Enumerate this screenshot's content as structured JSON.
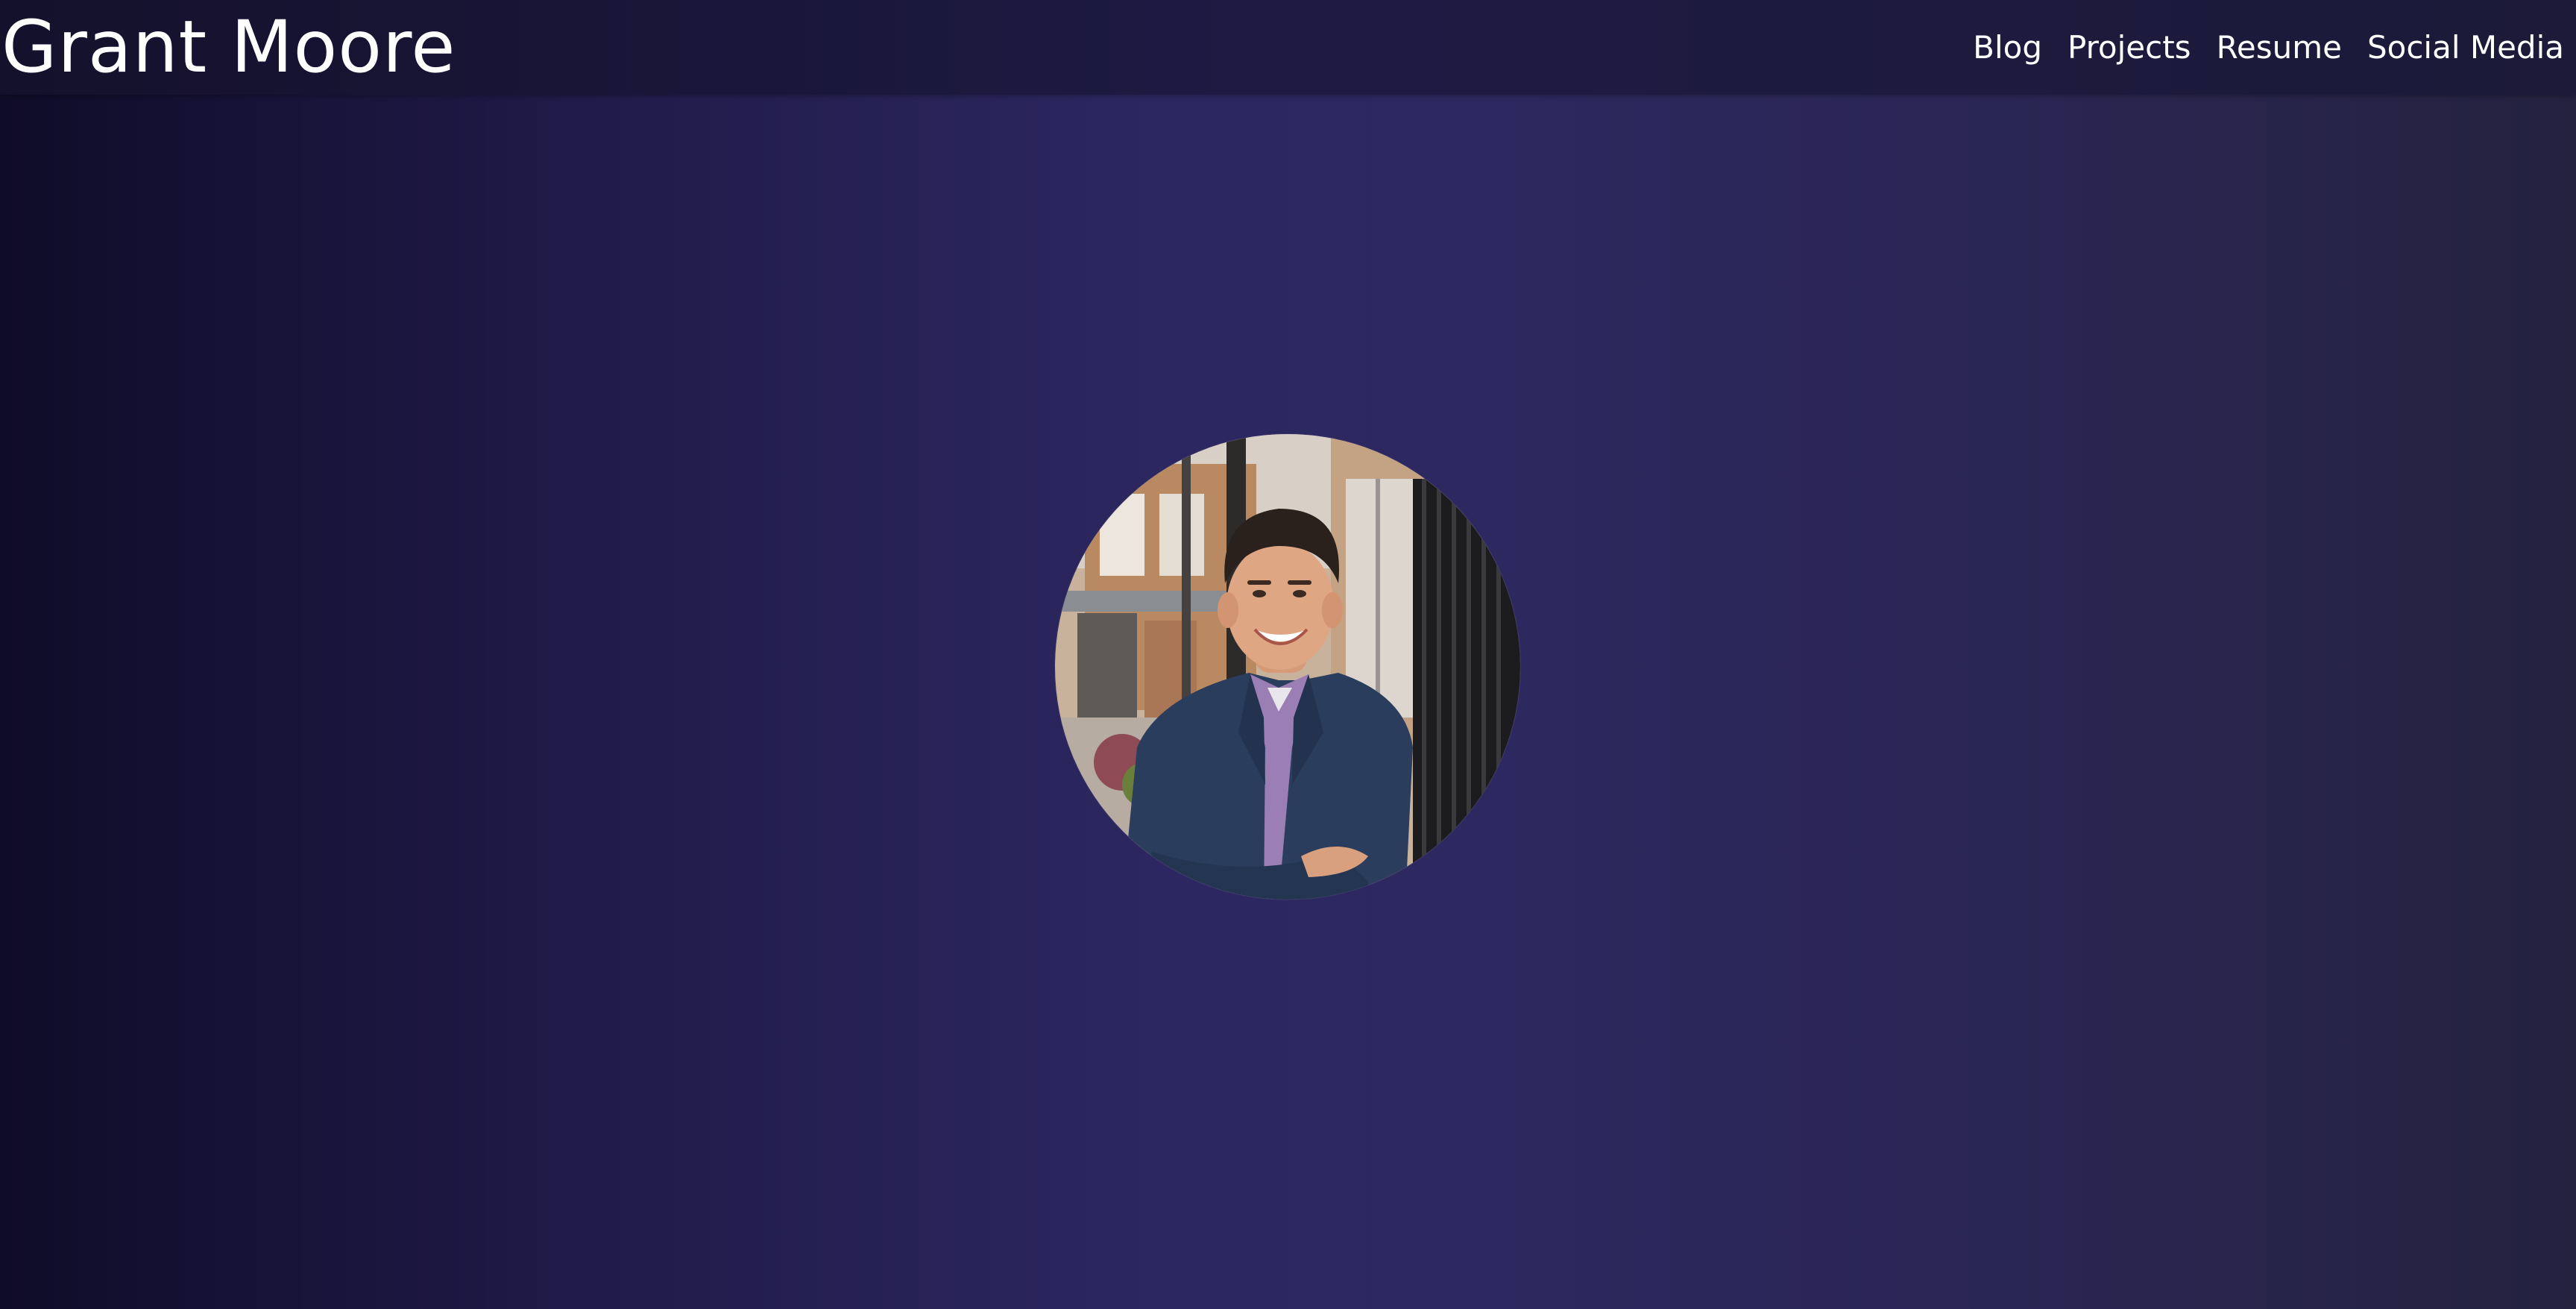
{
  "header": {
    "brand": "Grant Moore",
    "nav": [
      {
        "label": "Blog"
      },
      {
        "label": "Projects"
      },
      {
        "label": "Resume"
      },
      {
        "label": "Social Media"
      }
    ]
  },
  "colors": {
    "background_left": "#0f0c29",
    "background_center": "#2d285f",
    "background_right": "#24223f",
    "navbar": "#1e1a44",
    "text": "#ffffff"
  },
  "main": {
    "profile_photo": "profile-photo"
  }
}
